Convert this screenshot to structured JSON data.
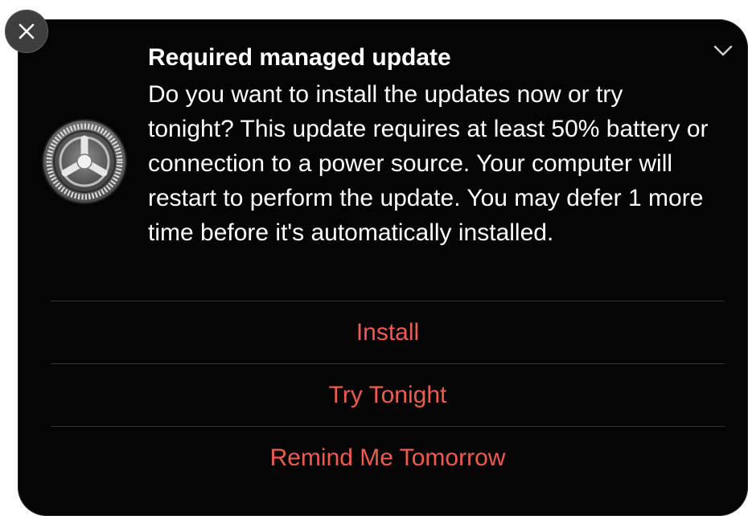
{
  "notification": {
    "title": "Required managed update",
    "body": "Do you want to install the updates now or try tonight? This update requires at least 50% battery or connection to a power source. Your computer will restart to perform the update. You may defer 1 more time before it's automatically installed.",
    "app_icon": "system-preferences-gear-icon",
    "close_icon": "close-icon",
    "expand_icon": "chevron-down-icon"
  },
  "actions": [
    {
      "label": "Install"
    },
    {
      "label": "Try Tonight"
    },
    {
      "label": "Remind Me Tomorrow"
    }
  ],
  "colors": {
    "background": "#050505",
    "text": "#ffffff",
    "action": "#ee5b4f",
    "divider": "#333333",
    "close_button": "#3e3e3e"
  }
}
